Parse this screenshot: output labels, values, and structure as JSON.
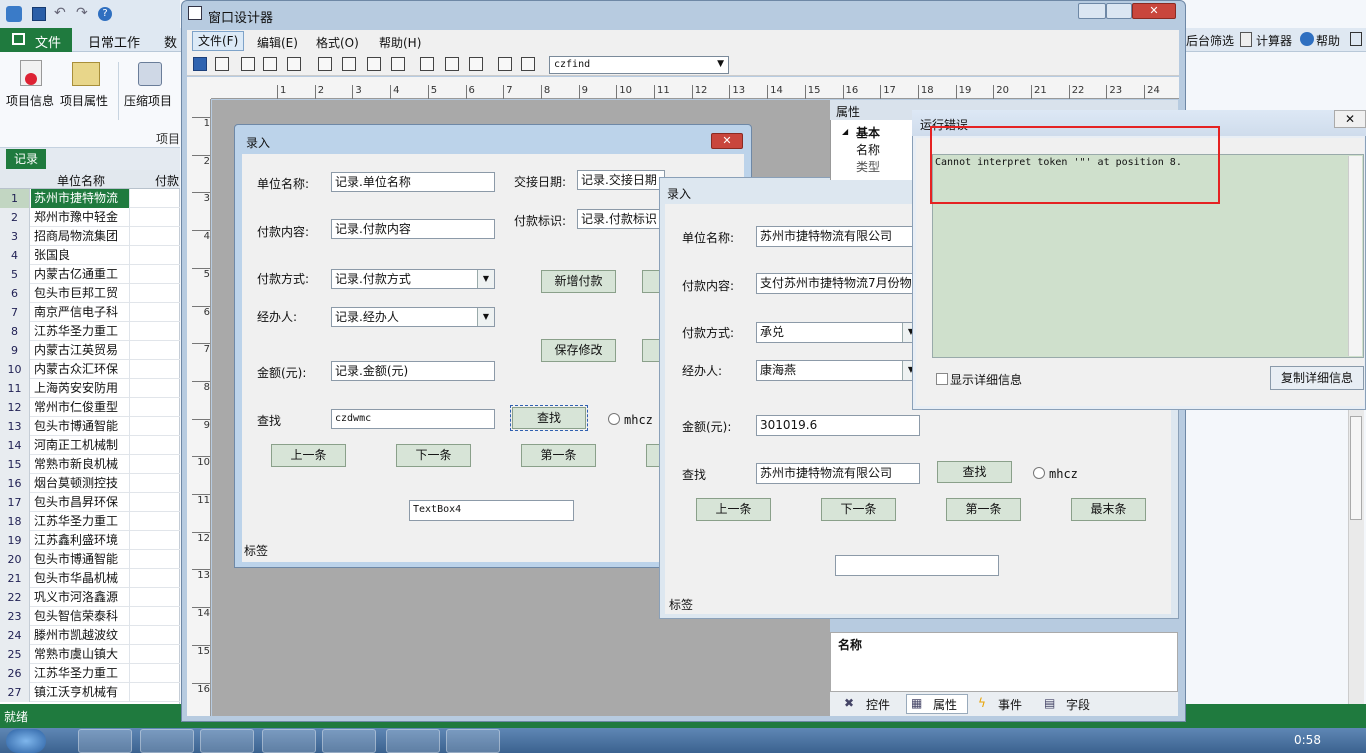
{
  "app": {
    "tabs": [
      "文件",
      "日常工作",
      "数"
    ],
    "toolbar_right": [
      "后台筛选",
      "计算器",
      "帮助"
    ],
    "ribbon": [
      "项目信息",
      "项目属性",
      "压缩项目"
    ],
    "ribbon_group": "项目",
    "status": "就绪",
    "clock": "0:58"
  },
  "sheet": {
    "tab": "记录",
    "col1": "单位名称",
    "col2": "付款",
    "rows": [
      {
        "n": "1",
        "name": "苏州市捷特物流"
      },
      {
        "n": "2",
        "name": "郑州市豫中轻金"
      },
      {
        "n": "3",
        "name": "招商局物流集团"
      },
      {
        "n": "4",
        "name": "张国良"
      },
      {
        "n": "5",
        "name": "内蒙古亿通重工"
      },
      {
        "n": "6",
        "name": "包头市巨邦工贸"
      },
      {
        "n": "7",
        "name": "南京严信电子科"
      },
      {
        "n": "8",
        "name": "江苏华圣力重工"
      },
      {
        "n": "9",
        "name": "内蒙古江英贸易"
      },
      {
        "n": "10",
        "name": "内蒙古众汇环保"
      },
      {
        "n": "11",
        "name": "上海芮安安防用"
      },
      {
        "n": "12",
        "name": "常州市仁俊重型"
      },
      {
        "n": "13",
        "name": "包头市博通智能"
      },
      {
        "n": "14",
        "name": "河南正工机械制"
      },
      {
        "n": "15",
        "name": "常熟市新良机械"
      },
      {
        "n": "16",
        "name": "烟台莫顿测控技"
      },
      {
        "n": "17",
        "name": "包头市昌昇环保"
      },
      {
        "n": "18",
        "name": "江苏华圣力重工"
      },
      {
        "n": "19",
        "name": "江苏鑫利盛环境"
      },
      {
        "n": "20",
        "name": "包头市博通智能"
      },
      {
        "n": "21",
        "name": "包头市华晶机械"
      },
      {
        "n": "22",
        "name": "巩义市河洛鑫源"
      },
      {
        "n": "23",
        "name": "包头智信荣泰科"
      },
      {
        "n": "24",
        "name": "滕州市凯越波纹"
      },
      {
        "n": "25",
        "name": "常熟市虞山镇大"
      },
      {
        "n": "26",
        "name": "江苏华圣力重工"
      },
      {
        "n": "27",
        "name": "镇江沃亨机械有"
      }
    ]
  },
  "designer": {
    "title": "窗口设计器",
    "menu": [
      "文件(F)",
      "编辑(E)",
      "格式(O)",
      "帮助(H)"
    ],
    "combo": "czfind",
    "ruler_top": [
      "1",
      "2",
      "3",
      "4",
      "5",
      "6",
      "7",
      "8",
      "9",
      "10",
      "11",
      "12",
      "13",
      "14",
      "15",
      "16",
      "17",
      "18",
      "19",
      "20",
      "21",
      "22",
      "23",
      "24"
    ],
    "ruler_left": [
      "1",
      "2",
      "3",
      "4",
      "5",
      "6",
      "7",
      "8",
      "9",
      "10",
      "11",
      "12",
      "13",
      "14",
      "15",
      "16"
    ],
    "props_title": "属性",
    "props_group": "基本",
    "props_items": [
      "名称",
      "类型"
    ],
    "desc_title": "名称",
    "bottom_tabs": [
      "控件",
      "属性",
      "事件",
      "字段"
    ]
  },
  "form1": {
    "title": "录入",
    "l_unit": "单位名称:",
    "v_unit": "记录.单位名称",
    "l_date": "交接日期:",
    "v_date": "记录.交接日期",
    "l_content": "付款内容:",
    "v_content": "记录.付款内容",
    "l_flag": "付款标识:",
    "v_flag": "记录.付款标识",
    "l_method": "付款方式:",
    "v_method": "记录.付款方式",
    "l_person": "经办人:",
    "v_person": "记录.经办人",
    "l_amount": "金额(元):",
    "v_amount": "记录.金额(元)",
    "l_find": "查找",
    "v_find": "czdwmc",
    "b_add": "新增付款",
    "b_save": "保存修改",
    "b_find": "查找",
    "radio": "mhcz",
    "b_prev": "上一条",
    "b_next": "下一条",
    "b_first": "第一条",
    "textbox": "TextBox4",
    "tag": "标签"
  },
  "form2": {
    "title": "录入",
    "l_unit": "单位名称:",
    "v_unit": "苏州市捷特物流有限公司",
    "l_content": "付款内容:",
    "v_content": "支付苏州市捷特物流7月份物",
    "l_method": "付款方式:",
    "v_method": "承兑",
    "l_person": "经办人:",
    "v_person": "康海燕",
    "l_amount": "金额(元):",
    "v_amount": "301019.6",
    "l_find": "查找",
    "v_find": "苏州市捷特物流有限公司",
    "b_find": "查找",
    "radio": "mhcz",
    "b_prev": "上一条",
    "b_next": "下一条",
    "b_first": "第一条",
    "b_last": "最末条",
    "tag": "标签"
  },
  "error": {
    "title": "运行错误",
    "message": "Cannot interpret token '\"' at position 8.",
    "checkbox": "显示详细信息",
    "copy_btn": "复制详细信息"
  }
}
